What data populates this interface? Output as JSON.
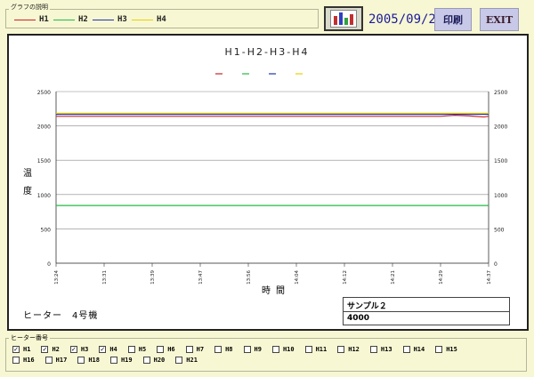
{
  "legend": {
    "caption": "グラフの説明",
    "items": [
      {
        "label": "H1",
        "color": "#cc2222"
      },
      {
        "label": "H2",
        "color": "#22bb44"
      },
      {
        "label": "H3",
        "color": "#2233aa"
      },
      {
        "label": "H4",
        "color": "#e8d000"
      }
    ]
  },
  "toolbar": {
    "date": "2005/09/20",
    "print_label": "印刷",
    "exit_label": "EXIT",
    "chart_icon": "bar-chart-icon"
  },
  "chart_data": {
    "type": "line",
    "title": "H1-H2-H3-H4",
    "ylabel_lines": [
      "温",
      "度"
    ],
    "xlabel": "時間",
    "ylim": [
      0,
      2500
    ],
    "yticks": [
      0,
      500,
      1000,
      1500,
      2000,
      2500
    ],
    "xticks": [
      "13:24",
      "13:31",
      "13:39",
      "13:47",
      "13:56",
      "14:04",
      "14:12",
      "14:21",
      "14:29",
      "14:37"
    ],
    "legend_placement": "top-center",
    "series": [
      {
        "name": "H1",
        "color": "#cc2222",
        "x": [
          0,
          1,
          2,
          3,
          4,
          5,
          6,
          7,
          8,
          8.3,
          8.6,
          8.9,
          9
        ],
        "values": [
          2140,
          2140,
          2140,
          2140,
          2140,
          2140,
          2140,
          2140,
          2140,
          2155,
          2145,
          2130,
          2140
        ]
      },
      {
        "name": "H2",
        "color": "#22bb44",
        "x": [
          0,
          9
        ],
        "values": [
          840,
          840
        ]
      },
      {
        "name": "H3",
        "color": "#2233aa",
        "x": [
          0,
          9
        ],
        "values": [
          2170,
          2170
        ]
      },
      {
        "name": "H4",
        "color": "#e8d000",
        "x": [
          0,
          9
        ],
        "values": [
          2185,
          2185
        ]
      }
    ]
  },
  "footer": {
    "heater_label": "ヒーター　4号機",
    "sample_name": "サンプル２",
    "sample_value": "4000"
  },
  "heater_select": {
    "caption": "ヒーター番号",
    "row1": [
      {
        "label": "H1",
        "checked": true
      },
      {
        "label": "H2",
        "checked": true
      },
      {
        "label": "H3",
        "checked": true
      },
      {
        "label": "H4",
        "checked": true
      },
      {
        "label": "H5",
        "checked": false
      },
      {
        "label": "H6",
        "checked": false
      },
      {
        "label": "H7",
        "checked": false
      },
      {
        "label": "H8",
        "checked": false
      },
      {
        "label": "H9",
        "checked": false
      },
      {
        "label": "H10",
        "checked": false
      },
      {
        "label": "H11",
        "checked": false
      },
      {
        "label": "H12",
        "checked": false
      },
      {
        "label": "H13",
        "checked": false
      },
      {
        "label": "H14",
        "checked": false
      },
      {
        "label": "H15",
        "checked": false
      }
    ],
    "row2": [
      {
        "label": "H16",
        "checked": false
      },
      {
        "label": "H17",
        "checked": false
      },
      {
        "label": "H18",
        "checked": false
      },
      {
        "label": "H19",
        "checked": false
      },
      {
        "label": "H20",
        "checked": false
      },
      {
        "label": "H21",
        "checked": false
      }
    ]
  }
}
